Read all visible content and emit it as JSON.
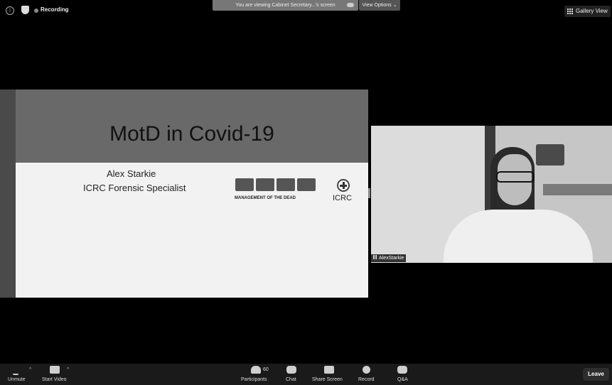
{
  "topbar": {
    "recording_label": "Recording",
    "viewing_text": "You are viewing Cabinet Secretary...'s screen",
    "view_options_label": "View Options ⌄",
    "gallery_view_label": "Gallery View"
  },
  "slide": {
    "title": "MotD in Covid-19",
    "presenter_name": "Alex Starkie",
    "presenter_role": "ICRC Forensic Specialist",
    "motd_caption": "MANAGEMENT OF THE DEAD",
    "org_label": "ICRC"
  },
  "video": {
    "participant_name": "AlexStarkie"
  },
  "toolbar": {
    "unmute_label": "Unmute",
    "start_video_label": "Start Video",
    "participants_label": "Participants",
    "participants_count": "60",
    "chat_label": "Chat",
    "share_screen_label": "Share Screen",
    "record_label": "Record",
    "qa_label": "Q&A",
    "leave_label": "Leave"
  },
  "colors": {
    "background": "#000000",
    "toolbar_bg": "#1a1a1a",
    "slide_header": "#696969"
  }
}
